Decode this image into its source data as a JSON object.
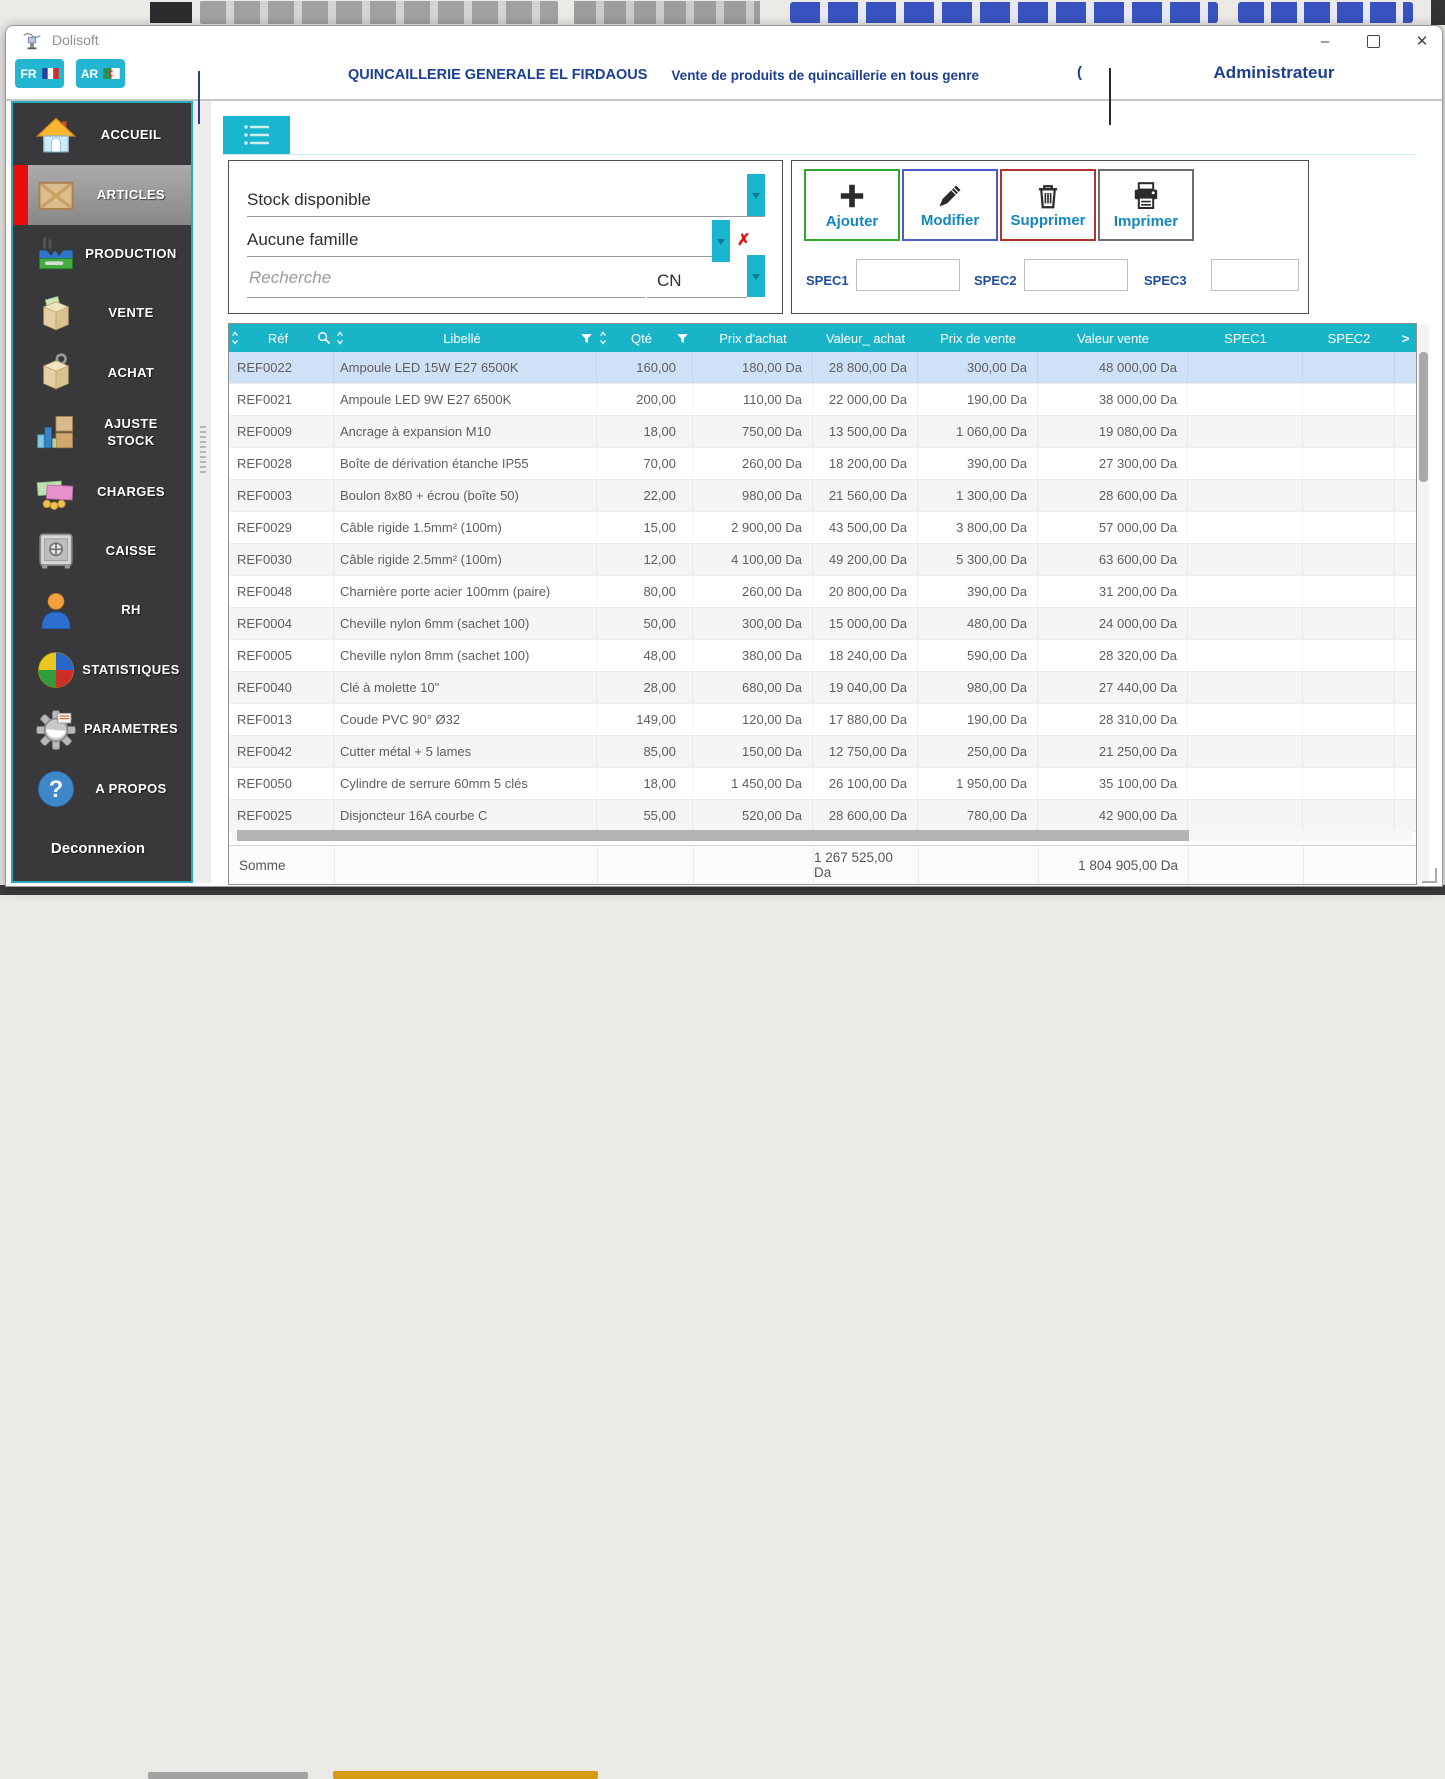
{
  "window": {
    "title": "Dolisoft",
    "controls": {
      "minimize": "–",
      "close": "✕"
    }
  },
  "header": {
    "lang_fr": "FR",
    "lang_ar": "AR",
    "company": "QUINCAILLERIE GENERALE EL FIRDAOUS",
    "tagline": "Vente de produits de quincaillerie en tous genre",
    "partial_text": "(",
    "user": "Administrateur"
  },
  "sidebar": {
    "items": [
      {
        "label": "ACCUEIL",
        "icon": "home-icon",
        "selected": false
      },
      {
        "label": "ARTICLES",
        "icon": "crate-icon",
        "selected": true
      },
      {
        "label": "PRODUCTION",
        "icon": "factory-icon",
        "selected": false
      },
      {
        "label": "VENTE",
        "icon": "sale-box-icon",
        "selected": false
      },
      {
        "label": "ACHAT",
        "icon": "purchase-box-icon",
        "selected": false
      },
      {
        "label": "AJUSTE STOCK",
        "icon": "stock-adjust-icon",
        "selected": false
      },
      {
        "label": "CHARGES",
        "icon": "money-icon",
        "selected": false
      },
      {
        "label": "CAISSE",
        "icon": "safe-icon",
        "selected": false
      },
      {
        "label": "RH",
        "icon": "person-icon",
        "selected": false
      },
      {
        "label": "STATISTIQUES",
        "icon": "pie-chart-icon",
        "selected": false
      },
      {
        "label": "PARAMETRES",
        "icon": "gear-icon",
        "selected": false
      },
      {
        "label": "A PROPOS",
        "icon": "question-icon",
        "selected": false
      }
    ],
    "logout": "Deconnexion"
  },
  "filters": {
    "stock": "Stock disponible",
    "famille": "Aucune famille",
    "search_placeholder": "Recherche",
    "search_mode": "CN"
  },
  "actions": {
    "add": "Ajouter",
    "edit": "Modifier",
    "delete": "Supprimer",
    "print": "Imprimer"
  },
  "specs": {
    "spec1_label": "SPEC1",
    "spec1_value": "",
    "spec2_label": "SPEC2",
    "spec2_value": "",
    "spec3_label": "SPEC3",
    "spec3_value": ""
  },
  "table": {
    "columns": [
      "Réf",
      "Libellé",
      "Qté",
      "Prix d'achat",
      "Valeur_ achat",
      "Prix de vente",
      "Valeur vente",
      "SPEC1",
      "SPEC2"
    ],
    "selected_row": 0,
    "rows": [
      {
        "ref": "REF0022",
        "libelle": "Ampoule LED 15W E27 6500K",
        "qte": "160,00",
        "prix_achat": "180,00 Da",
        "valeur_achat": "28 800,00 Da",
        "prix_vente": "300,00 Da",
        "valeur_vente": "48 000,00 Da",
        "spec1": "",
        "spec2": ""
      },
      {
        "ref": "REF0021",
        "libelle": "Ampoule LED 9W E27 6500K",
        "qte": "200,00",
        "prix_achat": "110,00 Da",
        "valeur_achat": "22 000,00 Da",
        "prix_vente": "190,00 Da",
        "valeur_vente": "38 000,00 Da",
        "spec1": "",
        "spec2": ""
      },
      {
        "ref": "REF0009",
        "libelle": "Ancrage à expansion M10",
        "qte": "18,00",
        "prix_achat": "750,00 Da",
        "valeur_achat": "13 500,00 Da",
        "prix_vente": "1 060,00 Da",
        "valeur_vente": "19 080,00 Da",
        "spec1": "",
        "spec2": ""
      },
      {
        "ref": "REF0028",
        "libelle": "Boîte de dérivation étanche IP55",
        "qte": "70,00",
        "prix_achat": "260,00 Da",
        "valeur_achat": "18 200,00 Da",
        "prix_vente": "390,00 Da",
        "valeur_vente": "27 300,00 Da",
        "spec1": "",
        "spec2": ""
      },
      {
        "ref": "REF0003",
        "libelle": "Boulon 8x80 + écrou (boîte 50)",
        "qte": "22,00",
        "prix_achat": "980,00 Da",
        "valeur_achat": "21 560,00 Da",
        "prix_vente": "1 300,00 Da",
        "valeur_vente": "28 600,00 Da",
        "spec1": "",
        "spec2": ""
      },
      {
        "ref": "REF0029",
        "libelle": "Câble rigide 1.5mm² (100m)",
        "qte": "15,00",
        "prix_achat": "2 900,00 Da",
        "valeur_achat": "43 500,00 Da",
        "prix_vente": "3 800,00 Da",
        "valeur_vente": "57 000,00 Da",
        "spec1": "",
        "spec2": ""
      },
      {
        "ref": "REF0030",
        "libelle": "Câble rigide 2.5mm² (100m)",
        "qte": "12,00",
        "prix_achat": "4 100,00 Da",
        "valeur_achat": "49 200,00 Da",
        "prix_vente": "5 300,00 Da",
        "valeur_vente": "63 600,00 Da",
        "spec1": "",
        "spec2": ""
      },
      {
        "ref": "REF0048",
        "libelle": "Charnière porte acier 100mm (paire)",
        "qte": "80,00",
        "prix_achat": "260,00 Da",
        "valeur_achat": "20 800,00 Da",
        "prix_vente": "390,00 Da",
        "valeur_vente": "31 200,00 Da",
        "spec1": "",
        "spec2": ""
      },
      {
        "ref": "REF0004",
        "libelle": "Cheville nylon 6mm (sachet 100)",
        "qte": "50,00",
        "prix_achat": "300,00 Da",
        "valeur_achat": "15 000,00 Da",
        "prix_vente": "480,00 Da",
        "valeur_vente": "24 000,00 Da",
        "spec1": "",
        "spec2": ""
      },
      {
        "ref": "REF0005",
        "libelle": "Cheville nylon 8mm (sachet 100)",
        "qte": "48,00",
        "prix_achat": "380,00 Da",
        "valeur_achat": "18 240,00 Da",
        "prix_vente": "590,00 Da",
        "valeur_vente": "28 320,00 Da",
        "spec1": "",
        "spec2": ""
      },
      {
        "ref": "REF0040",
        "libelle": "Clé à molette 10\"",
        "qte": "28,00",
        "prix_achat": "680,00 Da",
        "valeur_achat": "19 040,00 Da",
        "prix_vente": "980,00 Da",
        "valeur_vente": "27 440,00 Da",
        "spec1": "",
        "spec2": ""
      },
      {
        "ref": "REF0013",
        "libelle": "Coude PVC 90° Ø32",
        "qte": "149,00",
        "prix_achat": "120,00 Da",
        "valeur_achat": "17 880,00 Da",
        "prix_vente": "190,00 Da",
        "valeur_vente": "28 310,00 Da",
        "spec1": "",
        "spec2": ""
      },
      {
        "ref": "REF0042",
        "libelle": "Cutter métal + 5 lames",
        "qte": "85,00",
        "prix_achat": "150,00 Da",
        "valeur_achat": "12 750,00 Da",
        "prix_vente": "250,00 Da",
        "valeur_vente": "21 250,00 Da",
        "spec1": "",
        "spec2": ""
      },
      {
        "ref": "REF0050",
        "libelle": "Cylindre de serrure 60mm 5 clés",
        "qte": "18,00",
        "prix_achat": "1 450,00 Da",
        "valeur_achat": "26 100,00 Da",
        "prix_vente": "1 950,00 Da",
        "valeur_vente": "35 100,00 Da",
        "spec1": "",
        "spec2": ""
      },
      {
        "ref": "REF0025",
        "libelle": "Disjoncteur 16A courbe C",
        "qte": "55,00",
        "prix_achat": "520,00 Da",
        "valeur_achat": "28 600,00 Da",
        "prix_vente": "780,00 Da",
        "valeur_vente": "42 900,00 Da",
        "spec1": "",
        "spec2": ""
      }
    ],
    "somme_label": "Somme",
    "somme_valeur_achat": "1 267 525,00 Da",
    "somme_valeur_vente": "1 804 905,00 Da"
  },
  "colors": {
    "accent_cyan": "#1ab5cf",
    "header_blue_text": "#1c3f94",
    "sidebar_bg": "#39393b",
    "sidebar_selected_bg": "#9a9a9a",
    "selected_indicator_red": "#e60d0d",
    "table_header_bg": "#19b4c8",
    "selected_row_bg": "#cfe1f7",
    "add_border": "#2fa832",
    "edit_border": "#4c5ac8",
    "delete_border": "#b03434",
    "print_border": "#6e6e6e"
  }
}
